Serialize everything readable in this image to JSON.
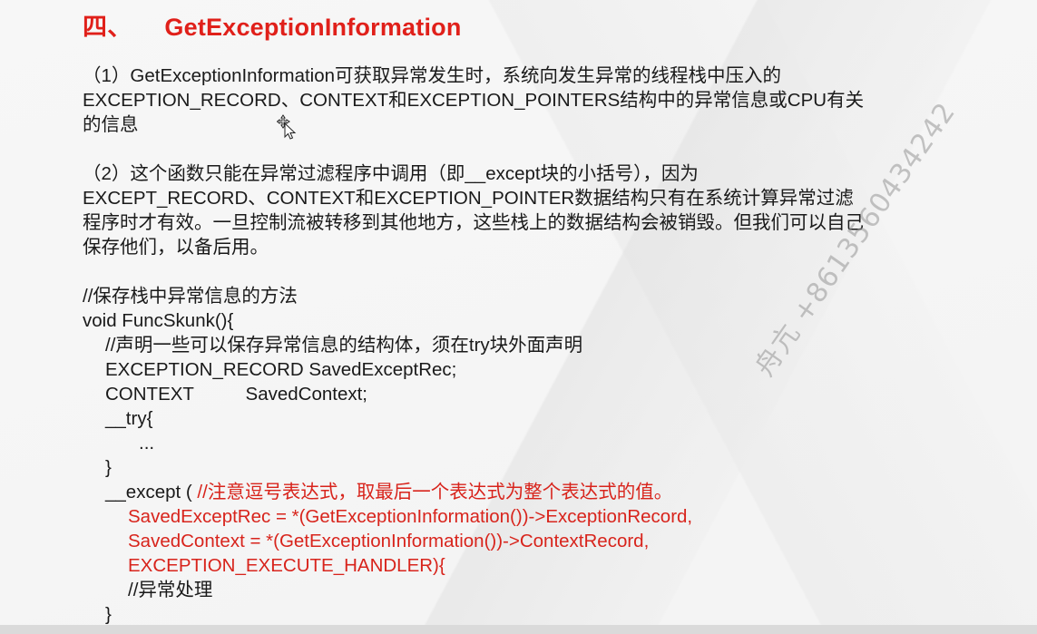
{
  "title": {
    "number": "四、",
    "text": "GetExceptionInformation"
  },
  "paragraph1": {
    "lines": [
      "（1）GetExceptionInformation可获取异常发生时，系统向发生异常的线程栈中压入的",
      "EXCEPTION_RECORD、CONTEXT和EXCEPTION_POINTERS结构中的异常信息或CPU有关",
      "的信息"
    ]
  },
  "paragraph2": {
    "lines": [
      "（2）这个函数只能在异常过滤程序中调用（即__except块的小括号），因为",
      "EXCEPT_RECORD、CONTEXT和EXCEPTION_POINTER数据结构只有在系统计算异常过滤",
      "程序时才有效。一旦控制流被转移到其他地方，这些栈上的数据结构会被销毁。但我们可以自己",
      "保存他们，以备后用。"
    ]
  },
  "code": {
    "comment_title": "//保存栈中异常信息的方法",
    "func_sig": "void FuncSkunk(){",
    "comment_declare": "//声明一些可以保存异常信息的结构体，须在try块外面声明",
    "decl_record": "EXCEPTION_RECORD SavedExceptRec;",
    "decl_context": "CONTEXT          SavedContext;",
    "try_open": "__try{",
    "ellipsis": "...",
    "try_close": "}",
    "except_kw": "__except ( ",
    "except_comment": "//注意逗号表达式，取最后一个表达式为整个表达式的值。",
    "assign_record": "SavedExceptRec = *(GetExceptionInformation())->ExceptionRecord,",
    "assign_context": "SavedContext = *(GetExceptionInformation())->ContextRecord,",
    "handler": "EXCEPTION_EXECUTE_HANDLER){",
    "handle_comment": "//异常处理",
    "block_close": "}"
  },
  "watermark": {
    "text": "舟亢 +8613560434242"
  },
  "colors": {
    "title_red": "#e0201a",
    "code_red": "#d8241c",
    "body_text": "#1a1a1a"
  },
  "icons": {
    "cursor": "move-cursor-icon"
  }
}
